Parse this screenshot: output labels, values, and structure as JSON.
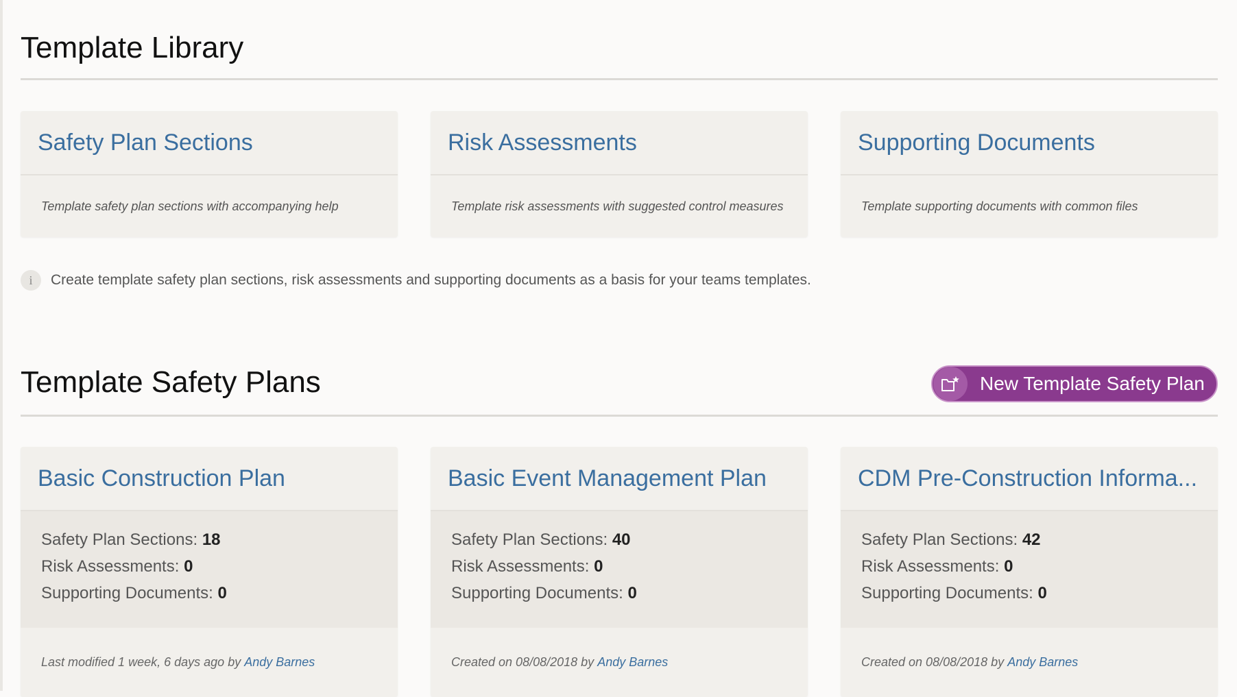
{
  "library": {
    "title": "Template Library",
    "cards": [
      {
        "title": "Safety Plan Sections",
        "description": "Template safety plan sections with accompanying help"
      },
      {
        "title": "Risk Assessments",
        "description": "Template risk assessments with suggested control measures"
      },
      {
        "title": "Supporting Documents",
        "description": "Template supporting documents with common files"
      }
    ],
    "info": {
      "icon": "info-icon",
      "glyph": "i",
      "text": "Create template safety plan sections, risk assessments and supporting documents as a basis for your teams templates."
    }
  },
  "plans": {
    "title": "Template Safety Plans",
    "new_button": {
      "label": "New Template Safety Plan",
      "icon": "folder-star-icon"
    },
    "labels": {
      "sections": "Safety Plan Sections:",
      "risks": "Risk Assessments:",
      "docs": "Supporting Documents:",
      "by": "by"
    },
    "items": [
      {
        "title": "Basic Construction Plan",
        "sections": "18",
        "risks": "0",
        "docs": "0",
        "meta": "Last modified 1 week, 6 days ago",
        "author": "Andy Barnes"
      },
      {
        "title": "Basic Event Management Plan",
        "sections": "40",
        "risks": "0",
        "docs": "0",
        "meta": "Created on 08/08/2018",
        "author": "Andy Barnes"
      },
      {
        "title": "CDM Pre-Construction Informa...",
        "sections": "42",
        "risks": "0",
        "docs": "0",
        "meta": "Created on 08/08/2018",
        "author": "Andy Barnes"
      }
    ]
  },
  "colors": {
    "accent_blue": "#3a6e9f",
    "button_purple": "#8a3a8e",
    "background": "#fbfaf9"
  }
}
